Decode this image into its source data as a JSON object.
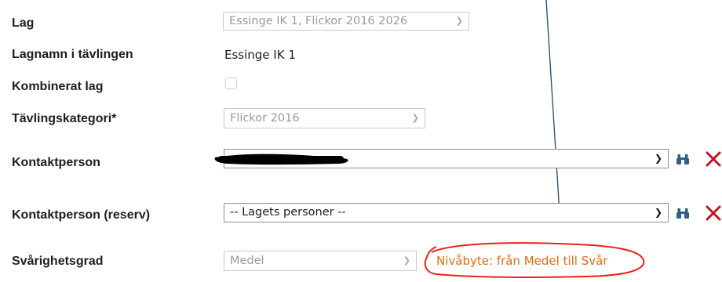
{
  "form": {
    "lag": {
      "label": "Lag",
      "value": "Essinge IK 1, Flickor 2016 2026"
    },
    "lagnamn": {
      "label": "Lagnamn i tävlingen",
      "value": "Essinge IK 1"
    },
    "kombinerat": {
      "label": "Kombinerat lag",
      "checked": false
    },
    "kategori": {
      "label": "Tävlingskategori*",
      "value": "Flickor 2016"
    },
    "kontakt": {
      "label": "Kontaktperson",
      "value": ""
    },
    "reserv": {
      "label": "Kontaktperson (reserv)",
      "value": "-- Lagets personer --"
    },
    "svarighet": {
      "label": "Svårighetsgrad",
      "value": "Medel",
      "note": "Nivåbyte: från Medel till Svår"
    }
  },
  "icons": {
    "dropdown": "chevron-down-icon",
    "search": "binoculars-icon",
    "remove": "close-icon"
  },
  "colors": {
    "note_text": "#e36b12",
    "annotation_circle": "#e8231c",
    "arrow": "#1f4e79",
    "remove_icon": "#c0171e",
    "search_icon": "#2f5d8c",
    "redaction": "#000000"
  }
}
